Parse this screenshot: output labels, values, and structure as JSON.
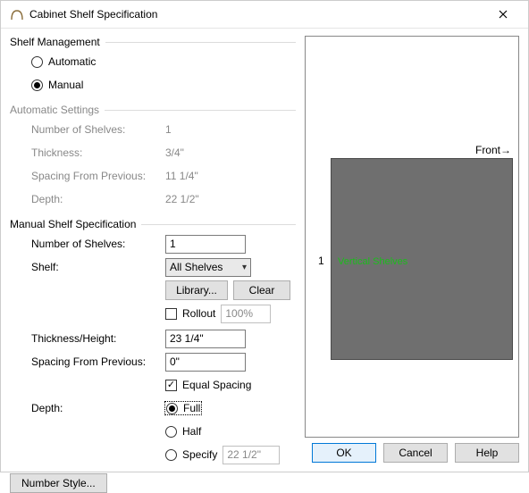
{
  "window": {
    "title": "Cabinet Shelf Specification"
  },
  "shelf_mgmt": {
    "header": "Shelf Management",
    "automatic": "Automatic",
    "manual": "Manual",
    "selected": "manual"
  },
  "auto": {
    "header": "Automatic Settings",
    "num_label": "Number of Shelves:",
    "num_value": "1",
    "thick_label": "Thickness:",
    "thick_value": "3/4\"",
    "spacing_label": "Spacing From Previous:",
    "spacing_value": "11 1/4\"",
    "depth_label": "Depth:",
    "depth_value": "22 1/2\""
  },
  "manual": {
    "header": "Manual Shelf Specification",
    "num_label": "Number of Shelves:",
    "num_value": "1",
    "shelf_label": "Shelf:",
    "shelf_value": "All Shelves",
    "library_btn": "Library...",
    "clear_btn": "Clear",
    "rollout_label": "Rollout",
    "rollout_pct": "100%",
    "thick_label": "Thickness/Height:",
    "thick_value": "23 1/4\"",
    "spacing_label": "Spacing From Previous:",
    "spacing_value": "0\"",
    "equal_label": "Equal Spacing",
    "depth_label": "Depth:",
    "depth_full": "Full",
    "depth_half": "Half",
    "depth_specify": "Specify",
    "depth_specify_value": "22 1/2\""
  },
  "preview": {
    "front": "Front",
    "index": "1",
    "label": "Vertical Shelves"
  },
  "footer": {
    "number_style": "Number Style...",
    "ok": "OK",
    "cancel": "Cancel",
    "help": "Help"
  }
}
